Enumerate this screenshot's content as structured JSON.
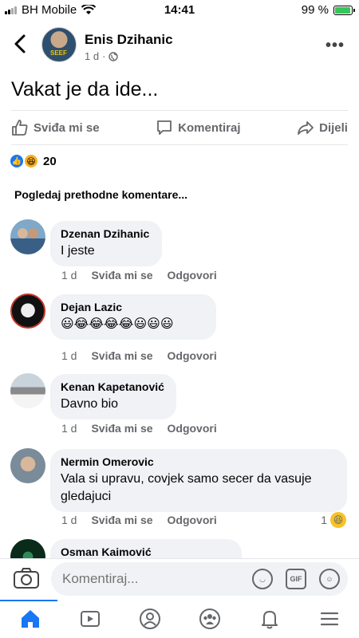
{
  "status_bar": {
    "carrier": "BH Mobile",
    "time": "14:41",
    "battery": "99 %",
    "battery_level": 0.99
  },
  "post": {
    "author": "Enis Dzihanic",
    "time": "1 d",
    "text": "Vakat je da ide...",
    "actions": {
      "like": "Sviđa mi se",
      "comment": "Komentiraj",
      "share": "Dijeli"
    },
    "reaction_count": "20",
    "reaction_icons": [
      "like-reaction-icon",
      "haha-reaction-icon"
    ]
  },
  "comments_header": "Pogledaj prethodne komentare...",
  "comments": [
    {
      "name": "Dzenan Dzihanic",
      "text": "I jeste",
      "time": "1 d",
      "like": "Sviđa mi se",
      "reply": "Odgovori"
    },
    {
      "name": "Dejan Lazic",
      "text": "😃😂😂😂😂😃😃😃",
      "time": "1 d",
      "like": "Sviđa mi se",
      "reply": "Odgovori"
    },
    {
      "name": "Kenan Kapetanović",
      "text": "Davno bio",
      "time": "1 d",
      "like": "Sviđa mi se",
      "reply": "Odgovori"
    },
    {
      "name": "Nermin Omerovic",
      "text": "Vala si upravu, covjek samo secer da vasuje gledajuci",
      "time": "1 d",
      "like": "Sviđa mi se",
      "reply": "Odgovori",
      "reaction_count": "1"
    },
    {
      "name": "Osman Kaimović"
    }
  ],
  "composer": {
    "placeholder": "Komentiraj...",
    "gif_label": "GIF"
  },
  "colors": {
    "accent": "#1877f2",
    "bubble": "#f0f2f5",
    "secondary_text": "#65676b",
    "battery": "#34c759"
  }
}
